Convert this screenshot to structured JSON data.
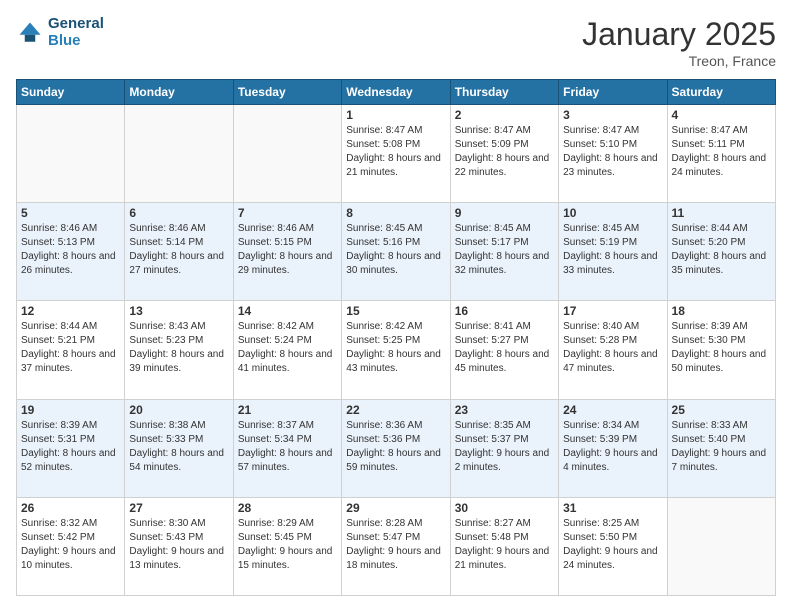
{
  "header": {
    "logo_line1": "General",
    "logo_line2": "Blue",
    "title": "January 2025",
    "subtitle": "Treon, France"
  },
  "days_of_week": [
    "Sunday",
    "Monday",
    "Tuesday",
    "Wednesday",
    "Thursday",
    "Friday",
    "Saturday"
  ],
  "weeks": [
    [
      {
        "day": "",
        "info": ""
      },
      {
        "day": "",
        "info": ""
      },
      {
        "day": "",
        "info": ""
      },
      {
        "day": "1",
        "info": "Sunrise: 8:47 AM\nSunset: 5:08 PM\nDaylight: 8 hours and 21 minutes."
      },
      {
        "day": "2",
        "info": "Sunrise: 8:47 AM\nSunset: 5:09 PM\nDaylight: 8 hours and 22 minutes."
      },
      {
        "day": "3",
        "info": "Sunrise: 8:47 AM\nSunset: 5:10 PM\nDaylight: 8 hours and 23 minutes."
      },
      {
        "day": "4",
        "info": "Sunrise: 8:47 AM\nSunset: 5:11 PM\nDaylight: 8 hours and 24 minutes."
      }
    ],
    [
      {
        "day": "5",
        "info": "Sunrise: 8:46 AM\nSunset: 5:13 PM\nDaylight: 8 hours and 26 minutes."
      },
      {
        "day": "6",
        "info": "Sunrise: 8:46 AM\nSunset: 5:14 PM\nDaylight: 8 hours and 27 minutes."
      },
      {
        "day": "7",
        "info": "Sunrise: 8:46 AM\nSunset: 5:15 PM\nDaylight: 8 hours and 29 minutes."
      },
      {
        "day": "8",
        "info": "Sunrise: 8:45 AM\nSunset: 5:16 PM\nDaylight: 8 hours and 30 minutes."
      },
      {
        "day": "9",
        "info": "Sunrise: 8:45 AM\nSunset: 5:17 PM\nDaylight: 8 hours and 32 minutes."
      },
      {
        "day": "10",
        "info": "Sunrise: 8:45 AM\nSunset: 5:19 PM\nDaylight: 8 hours and 33 minutes."
      },
      {
        "day": "11",
        "info": "Sunrise: 8:44 AM\nSunset: 5:20 PM\nDaylight: 8 hours and 35 minutes."
      }
    ],
    [
      {
        "day": "12",
        "info": "Sunrise: 8:44 AM\nSunset: 5:21 PM\nDaylight: 8 hours and 37 minutes."
      },
      {
        "day": "13",
        "info": "Sunrise: 8:43 AM\nSunset: 5:23 PM\nDaylight: 8 hours and 39 minutes."
      },
      {
        "day": "14",
        "info": "Sunrise: 8:42 AM\nSunset: 5:24 PM\nDaylight: 8 hours and 41 minutes."
      },
      {
        "day": "15",
        "info": "Sunrise: 8:42 AM\nSunset: 5:25 PM\nDaylight: 8 hours and 43 minutes."
      },
      {
        "day": "16",
        "info": "Sunrise: 8:41 AM\nSunset: 5:27 PM\nDaylight: 8 hours and 45 minutes."
      },
      {
        "day": "17",
        "info": "Sunrise: 8:40 AM\nSunset: 5:28 PM\nDaylight: 8 hours and 47 minutes."
      },
      {
        "day": "18",
        "info": "Sunrise: 8:39 AM\nSunset: 5:30 PM\nDaylight: 8 hours and 50 minutes."
      }
    ],
    [
      {
        "day": "19",
        "info": "Sunrise: 8:39 AM\nSunset: 5:31 PM\nDaylight: 8 hours and 52 minutes."
      },
      {
        "day": "20",
        "info": "Sunrise: 8:38 AM\nSunset: 5:33 PM\nDaylight: 8 hours and 54 minutes."
      },
      {
        "day": "21",
        "info": "Sunrise: 8:37 AM\nSunset: 5:34 PM\nDaylight: 8 hours and 57 minutes."
      },
      {
        "day": "22",
        "info": "Sunrise: 8:36 AM\nSunset: 5:36 PM\nDaylight: 8 hours and 59 minutes."
      },
      {
        "day": "23",
        "info": "Sunrise: 8:35 AM\nSunset: 5:37 PM\nDaylight: 9 hours and 2 minutes."
      },
      {
        "day": "24",
        "info": "Sunrise: 8:34 AM\nSunset: 5:39 PM\nDaylight: 9 hours and 4 minutes."
      },
      {
        "day": "25",
        "info": "Sunrise: 8:33 AM\nSunset: 5:40 PM\nDaylight: 9 hours and 7 minutes."
      }
    ],
    [
      {
        "day": "26",
        "info": "Sunrise: 8:32 AM\nSunset: 5:42 PM\nDaylight: 9 hours and 10 minutes."
      },
      {
        "day": "27",
        "info": "Sunrise: 8:30 AM\nSunset: 5:43 PM\nDaylight: 9 hours and 13 minutes."
      },
      {
        "day": "28",
        "info": "Sunrise: 8:29 AM\nSunset: 5:45 PM\nDaylight: 9 hours and 15 minutes."
      },
      {
        "day": "29",
        "info": "Sunrise: 8:28 AM\nSunset: 5:47 PM\nDaylight: 9 hours and 18 minutes."
      },
      {
        "day": "30",
        "info": "Sunrise: 8:27 AM\nSunset: 5:48 PM\nDaylight: 9 hours and 21 minutes."
      },
      {
        "day": "31",
        "info": "Sunrise: 8:25 AM\nSunset: 5:50 PM\nDaylight: 9 hours and 24 minutes."
      },
      {
        "day": "",
        "info": ""
      }
    ]
  ]
}
